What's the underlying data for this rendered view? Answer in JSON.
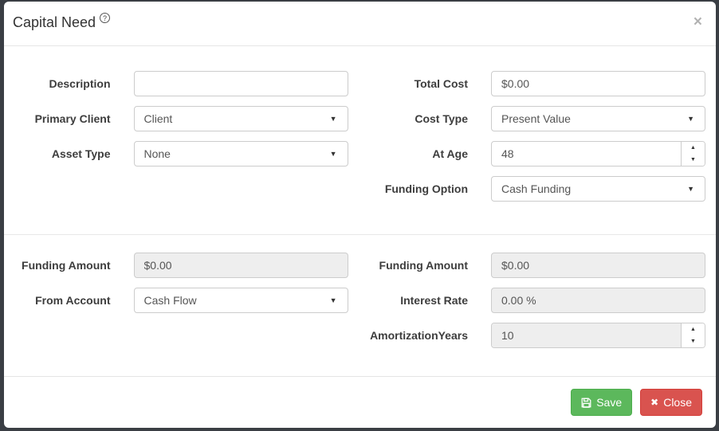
{
  "modal": {
    "title": "Capital Need"
  },
  "icons": {
    "help": "?",
    "close_x": "×",
    "caret": "▼",
    "spin_up": "▲",
    "spin_down": "▼",
    "close_btn_x": "✖"
  },
  "fields": {
    "description": {
      "label": "Description",
      "value": ""
    },
    "primary_client": {
      "label": "Primary Client",
      "value": "Client"
    },
    "asset_type": {
      "label": "Asset Type",
      "value": "None"
    },
    "total_cost": {
      "label": "Total Cost",
      "value": "$0.00"
    },
    "cost_type": {
      "label": "Cost Type",
      "value": "Present Value"
    },
    "at_age": {
      "label": "At Age",
      "value": "48"
    },
    "funding_option": {
      "label": "Funding Option",
      "value": "Cash Funding"
    },
    "funding_amount_left": {
      "label": "Funding Amount",
      "value": "$0.00"
    },
    "from_account": {
      "label": "From Account",
      "value": "Cash Flow"
    },
    "funding_amount_right": {
      "label": "Funding Amount",
      "value": "$0.00"
    },
    "interest_rate": {
      "label": "Interest Rate",
      "value": "0.00 %"
    },
    "amortization_years": {
      "label": "AmortizationYears",
      "value": "10"
    }
  },
  "footer": {
    "save_label": "Save",
    "close_label": "Close"
  },
  "colors": {
    "save_green": "#5cb85c",
    "close_red": "#d9534f",
    "backdrop": "#3a3e44"
  }
}
